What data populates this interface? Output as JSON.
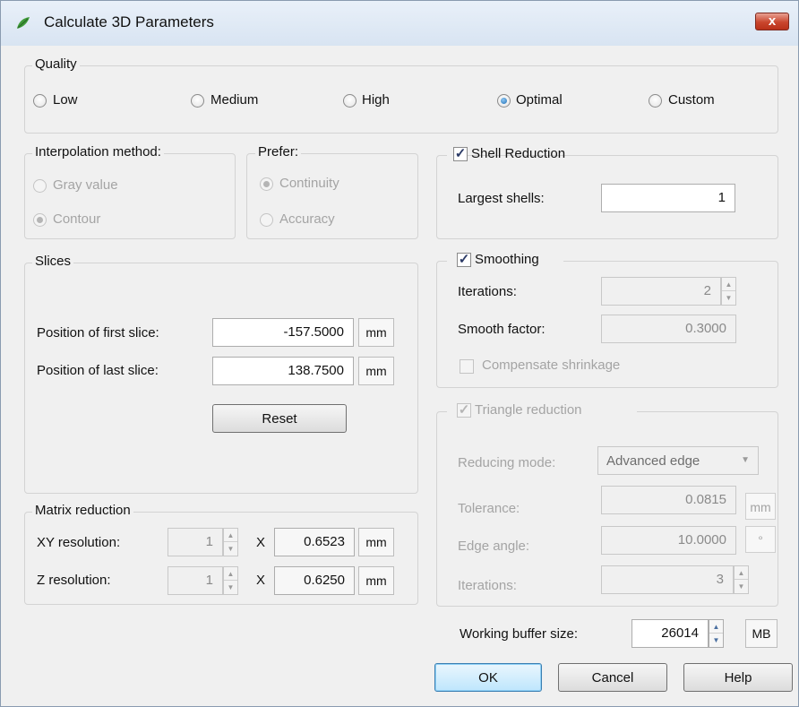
{
  "window": {
    "title": "Calculate 3D Parameters",
    "close_label": "x"
  },
  "quality": {
    "legend": "Quality",
    "options": [
      "Low",
      "Medium",
      "High",
      "Optimal",
      "Custom"
    ],
    "selected": "Optimal"
  },
  "interpolation": {
    "legend": "Interpolation method:",
    "options": [
      "Gray value",
      "Contour"
    ],
    "selected": "Contour"
  },
  "prefer": {
    "legend": "Prefer:",
    "options": [
      "Continuity",
      "Accuracy"
    ],
    "selected": "Continuity"
  },
  "slices": {
    "legend": "Slices",
    "first_label": "Position of first slice:",
    "first_value": "-157.5000",
    "last_label": "Position of last slice:",
    "last_value": "138.7500",
    "unit": "mm",
    "reset_label": "Reset"
  },
  "matrix": {
    "legend": "Matrix reduction",
    "xy_label": "XY resolution:",
    "xy_factor": "1",
    "xy_value": "0.6523",
    "z_label": "Z resolution:",
    "z_factor": "1",
    "z_value": "0.6250",
    "times": "X",
    "unit": "mm"
  },
  "shell": {
    "label": "Shell Reduction",
    "checked": true,
    "largest_label": "Largest shells:",
    "largest_value": "1"
  },
  "smoothing": {
    "label": "Smoothing",
    "checked": true,
    "iterations_label": "Iterations:",
    "iterations_value": "2",
    "factor_label": "Smooth factor:",
    "factor_value": "0.3000",
    "compensate_label": "Compensate shrinkage",
    "compensate_checked": false
  },
  "triangle": {
    "label": "Triangle reduction",
    "checked": true,
    "mode_label": "Reducing mode:",
    "mode_value": "Advanced edge",
    "tolerance_label": "Tolerance:",
    "tolerance_value": "0.0815",
    "tolerance_unit": "mm",
    "angle_label": "Edge angle:",
    "angle_value": "10.0000",
    "angle_unit": "°",
    "iterations_label": "Iterations:",
    "iterations_value": "3"
  },
  "buffer": {
    "label": "Working buffer size:",
    "value": "26014",
    "unit": "MB"
  },
  "buttons": {
    "ok": "OK",
    "cancel": "Cancel",
    "help": "Help"
  },
  "icons": {
    "app": "leaf-icon",
    "spin_up": "▲",
    "spin_down": "▼",
    "combo_arrow": "▼",
    "check": "✓"
  }
}
